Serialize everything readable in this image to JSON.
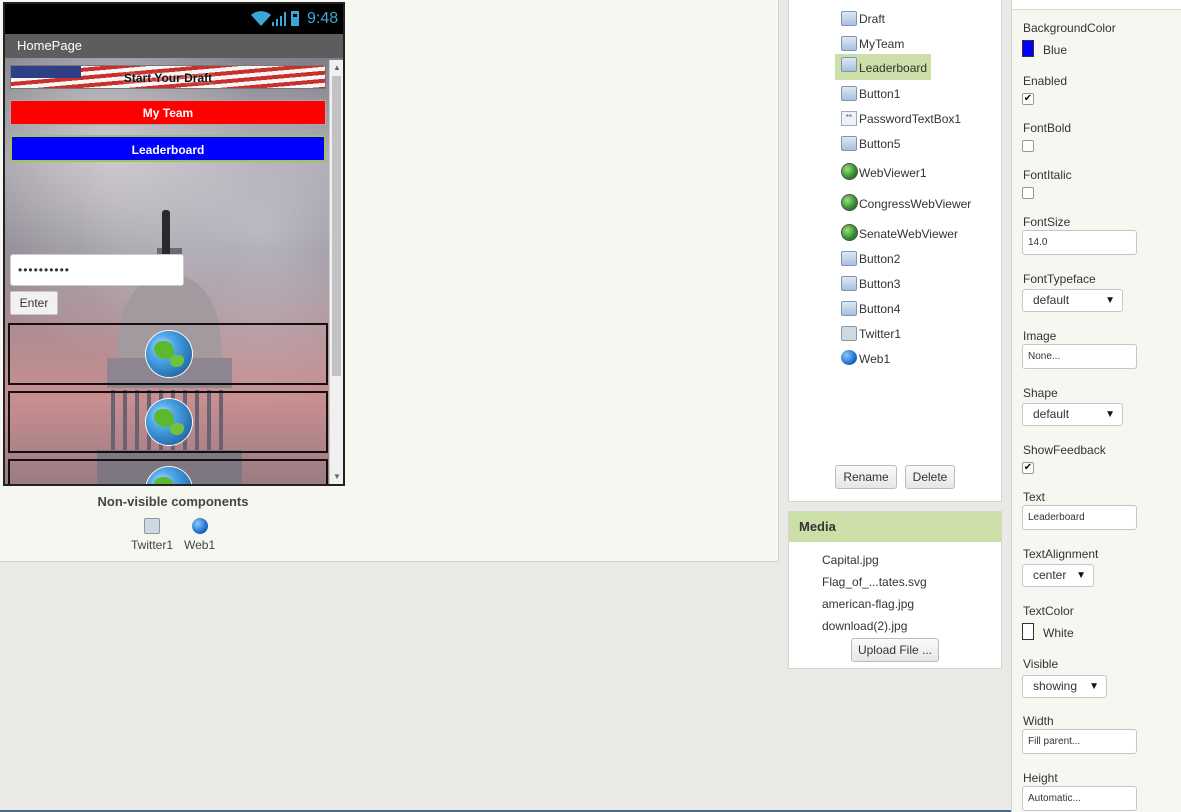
{
  "phone": {
    "status_time": "9:48",
    "title": "HomePage",
    "buttons": {
      "draft": "Start Your Draft",
      "myteam": "My Team",
      "leaderboard": "Leaderboard"
    },
    "password_value": "••••••••••",
    "enter_label": "Enter"
  },
  "nonvisible": {
    "title": "Non-visible components",
    "items": [
      "Twitter1",
      "Web1"
    ]
  },
  "components": {
    "items": [
      "Draft",
      "MyTeam",
      "Leaderboard",
      "Button1",
      "PasswordTextBox1",
      "Button5",
      "WebViewer1",
      "CongressWebViewer",
      "SenateWebViewer",
      "Button2",
      "Button3",
      "Button4",
      "Twitter1",
      "Web1"
    ],
    "selected": "Leaderboard",
    "rename_label": "Rename",
    "delete_label": "Delete"
  },
  "media": {
    "title": "Media",
    "files": [
      "Capital.jpg",
      "Flag_of_...tates.svg",
      "american-flag.jpg",
      "download(2).jpg"
    ],
    "upload_label": "Upload File ..."
  },
  "properties": {
    "background_color": {
      "label": "BackgroundColor",
      "value": "Blue",
      "swatch": "#0000ff"
    },
    "enabled": {
      "label": "Enabled",
      "checked": true
    },
    "font_bold": {
      "label": "FontBold",
      "checked": false
    },
    "font_italic": {
      "label": "FontItalic",
      "checked": false
    },
    "font_size": {
      "label": "FontSize",
      "value": "14.0"
    },
    "font_typeface": {
      "label": "FontTypeface",
      "value": "default"
    },
    "image": {
      "label": "Image",
      "value": "None..."
    },
    "shape": {
      "label": "Shape",
      "value": "default"
    },
    "show_feedback": {
      "label": "ShowFeedback",
      "checked": true
    },
    "text": {
      "label": "Text",
      "value": "Leaderboard"
    },
    "text_alignment": {
      "label": "TextAlignment",
      "value": "center"
    },
    "text_color": {
      "label": "TextColor",
      "value": "White",
      "swatch": "#ffffff"
    },
    "visible": {
      "label": "Visible",
      "value": "showing"
    },
    "width": {
      "label": "Width",
      "value": "Fill parent..."
    },
    "height": {
      "label": "Height",
      "value": "Automatic..."
    }
  },
  "colors": {
    "myteam_bg": "#ff0000",
    "leaderboard_bg": "#0000ff",
    "selection": "#cddfa9",
    "status_blue": "#3aa7d9"
  }
}
